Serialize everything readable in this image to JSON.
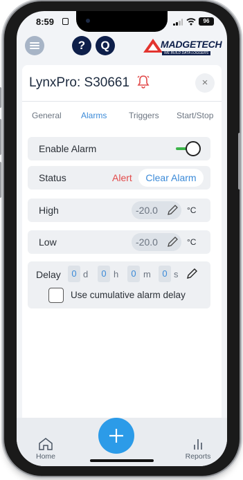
{
  "status_bar": {
    "time": "8:59",
    "battery": "96"
  },
  "header": {
    "help_label": "?",
    "q_label": "Q",
    "logo_text": "MADGETECH",
    "logo_tagline": "WE BUILD DATA LOGGERS",
    "brand_color": "#0e1f4a",
    "logo_accent": "#e3342f"
  },
  "panel": {
    "title": "LynxPro: S30661",
    "close_label": "×",
    "tabs": [
      "General",
      "Alarms",
      "Triggers",
      "Start/Stop"
    ],
    "active_tab": "Alarms"
  },
  "alarms": {
    "enable_label": "Enable Alarm",
    "enable_on": true,
    "status_label": "Status",
    "status_value": "Alert",
    "clear_button": "Clear Alarm",
    "high_label": "High",
    "high_value": "-20.0",
    "low_label": "Low",
    "low_value": "-20.0",
    "unit": "°C",
    "delay_label": "Delay",
    "delay": [
      {
        "value": "0",
        "unit": "d"
      },
      {
        "value": "0",
        "unit": "h"
      },
      {
        "value": "0",
        "unit": "m"
      },
      {
        "value": "0",
        "unit": "s"
      }
    ],
    "cumulative_label": "Use cumulative alarm delay",
    "cumulative_checked": false
  },
  "nav": {
    "home_label": "Home",
    "reports_label": "Reports"
  },
  "colors": {
    "accent": "#3b8ad8",
    "alert": "#e24a4a",
    "toggle_on": "#3cb44a",
    "fab": "#2c9be8"
  }
}
